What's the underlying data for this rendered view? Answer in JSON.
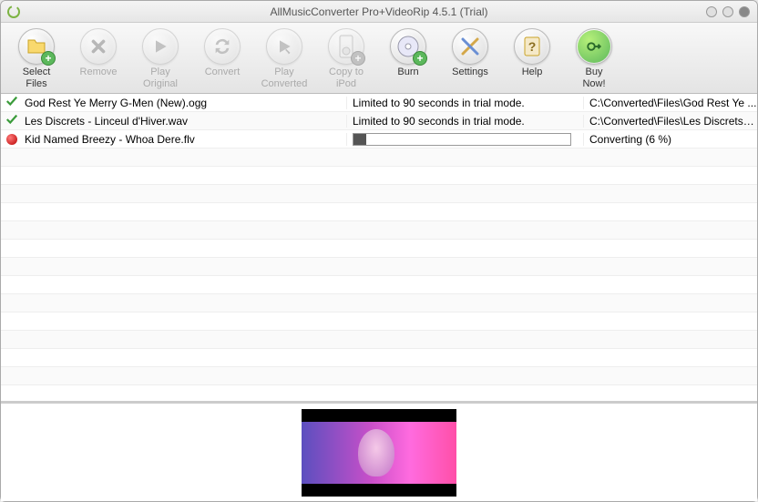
{
  "window": {
    "title": "AllMusicConverter Pro+VideoRip 4.5.1 (Trial)"
  },
  "toolbar": [
    {
      "id": "select-files",
      "line1": "Select",
      "line2": "Files",
      "enabled": true
    },
    {
      "id": "remove",
      "line1": "Remove",
      "line2": "",
      "enabled": false
    },
    {
      "id": "play-original",
      "line1": "Play",
      "line2": "Original",
      "enabled": false
    },
    {
      "id": "convert",
      "line1": "Convert",
      "line2": "",
      "enabled": false
    },
    {
      "id": "play-converted",
      "line1": "Play",
      "line2": "Converted",
      "enabled": false
    },
    {
      "id": "copy-to-ipod",
      "line1": "Copy to",
      "line2": "iPod",
      "enabled": false
    },
    {
      "id": "burn",
      "line1": "Burn",
      "line2": "",
      "enabled": true
    },
    {
      "id": "settings",
      "line1": "Settings",
      "line2": "",
      "enabled": true
    },
    {
      "id": "help",
      "line1": "Help",
      "line2": "",
      "enabled": true
    },
    {
      "id": "buy-now",
      "line1": "Buy",
      "line2": "Now!",
      "enabled": true
    }
  ],
  "files": [
    {
      "status": "done",
      "name": "God Rest Ye Merry G-Men (New).ogg",
      "message": "Limited to 90 seconds in trial mode.",
      "path": "C:\\Converted\\Files\\God Rest Ye ..."
    },
    {
      "status": "done",
      "name": "Les Discrets - Linceul d'Hiver.wav",
      "message": "Limited to 90 seconds in trial mode.",
      "path": "C:\\Converted\\Files\\Les Discrets - ..."
    },
    {
      "status": "converting",
      "name": "Kid Named Breezy - Whoa Dere.flv",
      "progress_pct": 6,
      "path_text": "Converting (6 %)"
    }
  ],
  "empty_rows": 15
}
